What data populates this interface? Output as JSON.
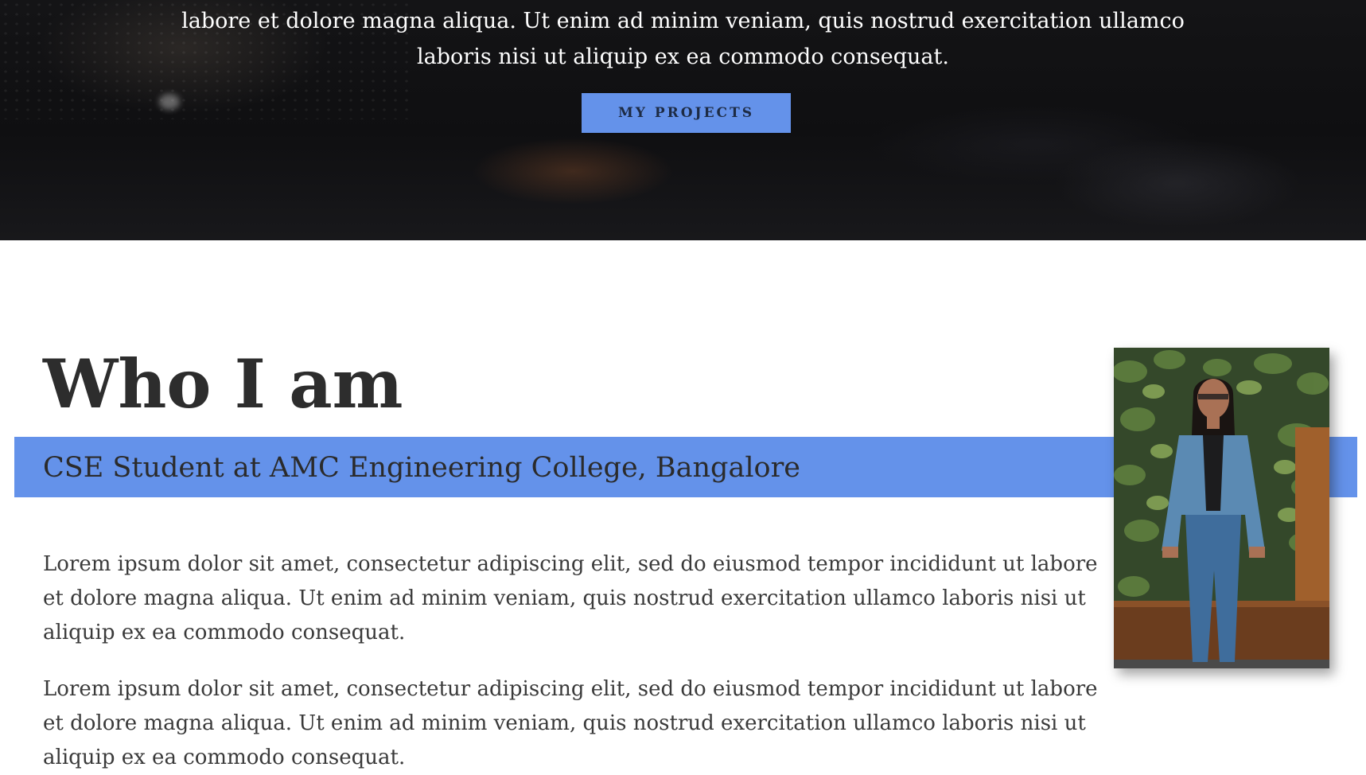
{
  "hero": {
    "line1": "labore et dolore magna aliqua. Ut enim ad minim veniam, quis nostrud exercitation ullamco",
    "line2": "laboris nisi ut aliquip ex ea commodo consequat.",
    "button_label": "MY PROJECTS"
  },
  "about": {
    "heading": "Who I am",
    "subtitle": "CSE Student at AMC Engineering College, Bangalore",
    "paragraphs": [
      "Lorem ipsum dolor sit amet, consectetur adipiscing elit, sed do eiusmod tempor incididunt ut labore et dolore magna aliqua. Ut enim ad minim veniam, quis nostrud exercitation ullamco laboris nisi ut aliquip ex ea commodo consequat.",
      "Lorem ipsum dolor sit amet, consectetur adipiscing elit, sed do eiusmod tempor incididunt ut labore et dolore magna aliqua. Ut enim ad minim veniam, quis nostrud exercitation ullamco laboris nisi ut aliquip ex ea commodo consequat."
    ]
  },
  "colors": {
    "accent": "#6492ea",
    "hero_background": "#131315",
    "text": "#333333"
  }
}
